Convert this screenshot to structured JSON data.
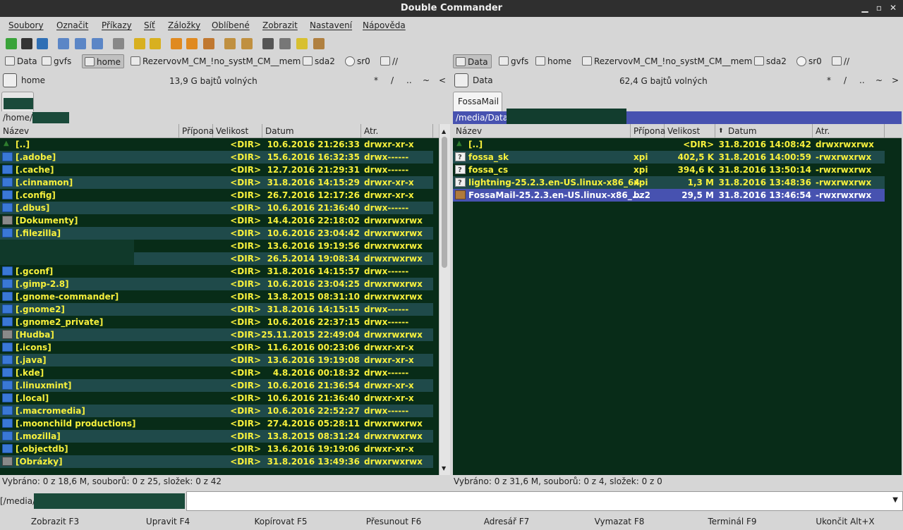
{
  "window": {
    "title": "Double Commander"
  },
  "menu": [
    "Soubory",
    "Označit",
    "Příkazy",
    "Síť",
    "Záložky",
    "Oblíbené",
    "Zobrazit",
    "Nastavení",
    "Nápověda"
  ],
  "toolbar_icons": [
    "refresh-icon",
    "terminal-icon",
    "network-icon",
    "brief-view-icon",
    "full-view-icon",
    "columns-view-icon",
    "tree-view-icon",
    "copy-left-icon",
    "copy-right-icon",
    "multi-rename-icon",
    "sync-dirs-icon",
    "plugin-icon",
    "pack-icon",
    "unpack-icon",
    "search-icon",
    "edit-icon",
    "folder-icon",
    "archive-icon"
  ],
  "left": {
    "drives": [
      {
        "label": "Data",
        "kind": "disk",
        "active": false
      },
      {
        "label": "gvfs",
        "kind": "disk",
        "active": false
      },
      {
        "label": "home",
        "kind": "disk",
        "active": true
      },
      {
        "label": "RezervovM_CM_!no_systM_CM__mem",
        "kind": "disk",
        "active": false
      },
      {
        "label": "sda2",
        "kind": "disk",
        "active": false
      },
      {
        "label": "sr0",
        "kind": "cd",
        "active": false
      },
      {
        "label": "//",
        "kind": "net",
        "active": false
      }
    ],
    "drive_name": "home",
    "free_space": "13,9 G bajtů volných",
    "nav": [
      "*",
      "/",
      "..",
      "~",
      "<"
    ],
    "tab": "",
    "path": "/home/",
    "columns": [
      "Název",
      "Přípona",
      "Velikost",
      "Datum",
      "Atr."
    ],
    "rows": [
      {
        "name": "[..]",
        "ext": "",
        "size": "<DIR>",
        "date": "10.6.2016 21:26:33",
        "attr": "drwxr-xr-x",
        "icon": "up"
      },
      {
        "name": "[.adobe]",
        "ext": "",
        "size": "<DIR>",
        "date": "15.6.2016 16:32:35",
        "attr": "drwx------",
        "icon": "folder"
      },
      {
        "name": "[.cache]",
        "ext": "",
        "size": "<DIR>",
        "date": "12.7.2016 21:29:31",
        "attr": "drwx------",
        "icon": "folder"
      },
      {
        "name": "[.cinnamon]",
        "ext": "",
        "size": "<DIR>",
        "date": "31.8.2016 14:15:29",
        "attr": "drwxr-xr-x",
        "icon": "folder"
      },
      {
        "name": "[.config]",
        "ext": "",
        "size": "<DIR>",
        "date": "26.7.2016 12:17:26",
        "attr": "drwxr-xr-x",
        "icon": "folder"
      },
      {
        "name": "[.dbus]",
        "ext": "",
        "size": "<DIR>",
        "date": "10.6.2016 21:36:40",
        "attr": "drwx------",
        "icon": "folder"
      },
      {
        "name": "[Dokumenty]",
        "ext": "",
        "size": "<DIR>",
        "date": "14.4.2016 22:18:02",
        "attr": "drwxrwxrwx",
        "icon": "special"
      },
      {
        "name": "[.filezilla]",
        "ext": "",
        "size": "<DIR>",
        "date": "10.6.2016 23:04:42",
        "attr": "drwxrwxrwx",
        "icon": "folder"
      },
      {
        "name": "",
        "ext": "",
        "size": "<DIR>",
        "date": "13.6.2016 19:19:56",
        "attr": "drwxrwxrwx",
        "icon": "none"
      },
      {
        "name": "",
        "ext": "",
        "size": "<DIR>",
        "date": "26.5.2014 19:08:34",
        "attr": "drwxrwxrwx",
        "icon": "none"
      },
      {
        "name": "[.gconf]",
        "ext": "",
        "size": "<DIR>",
        "date": "31.8.2016 14:15:57",
        "attr": "drwx------",
        "icon": "folder"
      },
      {
        "name": "[.gimp-2.8]",
        "ext": "",
        "size": "<DIR>",
        "date": "10.6.2016 23:04:25",
        "attr": "drwxrwxrwx",
        "icon": "folder"
      },
      {
        "name": "[.gnome-commander]",
        "ext": "",
        "size": "<DIR>",
        "date": "13.8.2015 08:31:10",
        "attr": "drwxrwxrwx",
        "icon": "folder"
      },
      {
        "name": "[.gnome2]",
        "ext": "",
        "size": "<DIR>",
        "date": "31.8.2016 14:15:15",
        "attr": "drwx------",
        "icon": "folder"
      },
      {
        "name": "[.gnome2_private]",
        "ext": "",
        "size": "<DIR>",
        "date": "10.6.2016 22:37:15",
        "attr": "drwx------",
        "icon": "folder"
      },
      {
        "name": "[Hudba]",
        "ext": "",
        "size": "<DIR>",
        "date": "25.11.2015 22:49:04",
        "attr": "drwxrwxrwx",
        "icon": "special"
      },
      {
        "name": "[.icons]",
        "ext": "",
        "size": "<DIR>",
        "date": "11.6.2016 00:23:06",
        "attr": "drwxr-xr-x",
        "icon": "folder"
      },
      {
        "name": "[.java]",
        "ext": "",
        "size": "<DIR>",
        "date": "13.6.2016 19:19:08",
        "attr": "drwxr-xr-x",
        "icon": "folder"
      },
      {
        "name": "[.kde]",
        "ext": "",
        "size": "<DIR>",
        "date": "4.8.2016 00:18:32",
        "attr": "drwx------",
        "icon": "folder"
      },
      {
        "name": "[.linuxmint]",
        "ext": "",
        "size": "<DIR>",
        "date": "10.6.2016 21:36:54",
        "attr": "drwxr-xr-x",
        "icon": "folder"
      },
      {
        "name": "[.local]",
        "ext": "",
        "size": "<DIR>",
        "date": "10.6.2016 21:36:40",
        "attr": "drwxr-xr-x",
        "icon": "folder"
      },
      {
        "name": "[.macromedia]",
        "ext": "",
        "size": "<DIR>",
        "date": "10.6.2016 22:52:27",
        "attr": "drwx------",
        "icon": "folder"
      },
      {
        "name": "[.moonchild productions]",
        "ext": "",
        "size": "<DIR>",
        "date": "27.4.2016 05:28:11",
        "attr": "drwxrwxrwx",
        "icon": "folder"
      },
      {
        "name": "[.mozilla]",
        "ext": "",
        "size": "<DIR>",
        "date": "13.8.2015 08:31:24",
        "attr": "drwxrwxrwx",
        "icon": "folder"
      },
      {
        "name": "[.objectdb]",
        "ext": "",
        "size": "<DIR>",
        "date": "13.6.2016 19:19:06",
        "attr": "drwxr-xr-x",
        "icon": "folder"
      },
      {
        "name": "[Obrázky]",
        "ext": "",
        "size": "<DIR>",
        "date": "31.8.2016 13:49:36",
        "attr": "drwxrwxrwx",
        "icon": "special"
      }
    ],
    "status": "Vybráno: 0 z 18,6 M, souborů: 0 z 25, složek: 0 z 42"
  },
  "right": {
    "drives": [
      {
        "label": "Data",
        "kind": "disk",
        "active": true
      },
      {
        "label": "gvfs",
        "kind": "disk",
        "active": false
      },
      {
        "label": "home",
        "kind": "disk",
        "active": false
      },
      {
        "label": "RezervovM_CM_!no_systM_CM__mem",
        "kind": "disk",
        "active": false
      },
      {
        "label": "sda2",
        "kind": "disk",
        "active": false
      },
      {
        "label": "sr0",
        "kind": "cd",
        "active": false
      },
      {
        "label": "//",
        "kind": "net",
        "active": false
      }
    ],
    "drive_name": "Data",
    "free_space": "62,4 G bajtů volných",
    "nav": [
      "*",
      "/",
      "..",
      "~",
      ">"
    ],
    "tab": "FossaMail",
    "path": "/media/Data/",
    "columns": [
      "Název",
      "Přípona",
      "Velikost",
      "Datum",
      "Atr."
    ],
    "rows": [
      {
        "name": "[..]",
        "ext": "",
        "size": "<DIR>",
        "date": "31.8.2016 14:08:42",
        "attr": "drwxrwxrwx",
        "icon": "up"
      },
      {
        "name": "fossa_sk",
        "ext": "xpi",
        "size": "402,5 K",
        "date": "31.8.2016 14:00:59",
        "attr": "-rwxrwxrwx",
        "icon": "unknown"
      },
      {
        "name": "fossa_cs",
        "ext": "xpi",
        "size": "394,6 K",
        "date": "31.8.2016 13:50:14",
        "attr": "-rwxrwxrwx",
        "icon": "unknown"
      },
      {
        "name": "lightning-25.2.3.en-US.linux-x86_64",
        "ext": "xpi",
        "size": "1,3 M",
        "date": "31.8.2016 13:48:36",
        "attr": "-rwxrwxrwx",
        "icon": "unknown"
      },
      {
        "name": "FossaMail-25.2.3.en-US.linux-x86_...",
        "ext": "bz2",
        "size": "29,5 M",
        "date": "31.8.2016 13:46:54",
        "attr": "-rwxrwxrwx",
        "icon": "archive",
        "selected": true
      }
    ],
    "status": "Vybráno: 0 z 31,6 M, souborů: 0 z 4, složek: 0 z 0"
  },
  "cmdline": {
    "prompt": "[/media/"
  },
  "fkeys": [
    "Zobrazit F3",
    "Upravit F4",
    "Kopírovat F5",
    "Přesunout F6",
    "Adresář F7",
    "Vymazat F8",
    "Terminál F9",
    "Ukončit Alt+X"
  ],
  "colors": {
    "panel_bg": "#082c18",
    "alt_row": "#1f4a4a",
    "text": "#f7f03c",
    "selection": "#4752b0"
  }
}
